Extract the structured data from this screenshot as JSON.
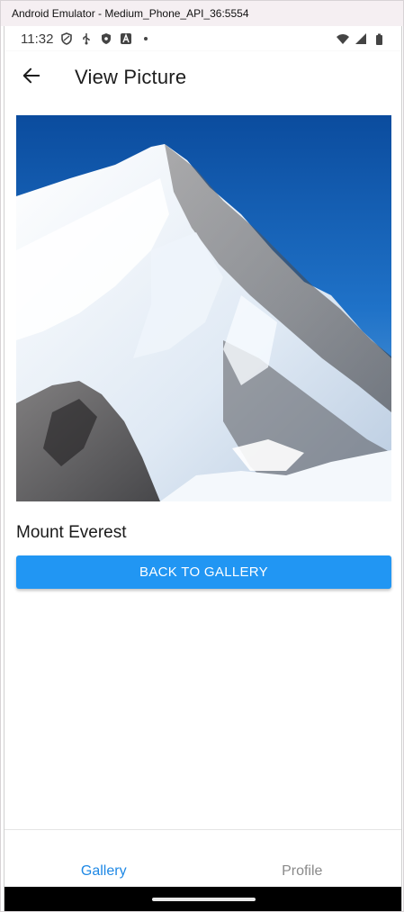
{
  "emulator": {
    "title": "Android Emulator - Medium_Phone_API_36:5554"
  },
  "status_bar": {
    "time": "11:32",
    "left_icons": [
      "shield-outline-icon",
      "usb-icon",
      "shield-filled-icon",
      "font-a-icon",
      "dot-icon"
    ],
    "right_icons": [
      "wifi-icon",
      "signal-icon",
      "battery-icon"
    ]
  },
  "app_bar": {
    "title": "View Picture",
    "back_icon": "arrow-back-icon"
  },
  "picture": {
    "name": "Mount Everest"
  },
  "actions": {
    "back_to_gallery_label": "BACK TO GALLERY"
  },
  "bottom_nav": {
    "items": [
      {
        "label": "Gallery",
        "active": true
      },
      {
        "label": "Profile",
        "active": false
      }
    ]
  },
  "colors": {
    "accent": "#2196f3",
    "nav_active": "#1e88e5",
    "nav_inactive": "#8a8a8a"
  }
}
